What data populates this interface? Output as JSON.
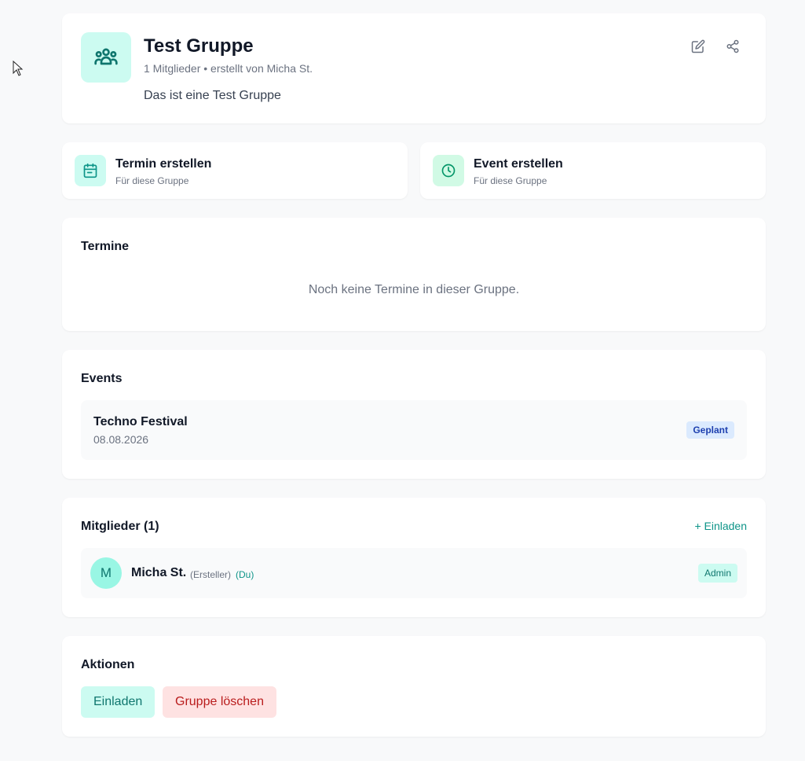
{
  "group": {
    "title": "Test Gruppe",
    "meta": "1 Mitglieder • erstellt von Micha St.",
    "description": "Das ist eine Test Gruppe",
    "icon": "users-group-icon"
  },
  "quick_actions": [
    {
      "title": "Termin erstellen",
      "subtitle": "Für diese Gruppe",
      "icon": "calendar-icon"
    },
    {
      "title": "Event erstellen",
      "subtitle": "Für diese Gruppe",
      "icon": "clock-icon"
    }
  ],
  "termine": {
    "title": "Termine",
    "empty": "Noch keine Termine in dieser Gruppe."
  },
  "events": {
    "title": "Events",
    "items": [
      {
        "name": "Techno Festival",
        "date": "08.08.2026",
        "status": "Geplant"
      }
    ]
  },
  "members": {
    "title": "Mitglieder (1)",
    "invite_link": "+ Einladen",
    "items": [
      {
        "initial": "M",
        "name": "Micha St.",
        "creator_tag": "(Ersteller)",
        "you_tag": "(Du)",
        "role": "Admin"
      }
    ]
  },
  "actions": {
    "title": "Aktionen",
    "invite_label": "Einladen",
    "delete_label": "Gruppe löschen"
  },
  "colors": {
    "accent": "#0d9488",
    "accent_light": "#ccfbf1",
    "danger": "#b91c1c",
    "danger_light": "#fee2e2",
    "background": "#f8f9fa"
  }
}
